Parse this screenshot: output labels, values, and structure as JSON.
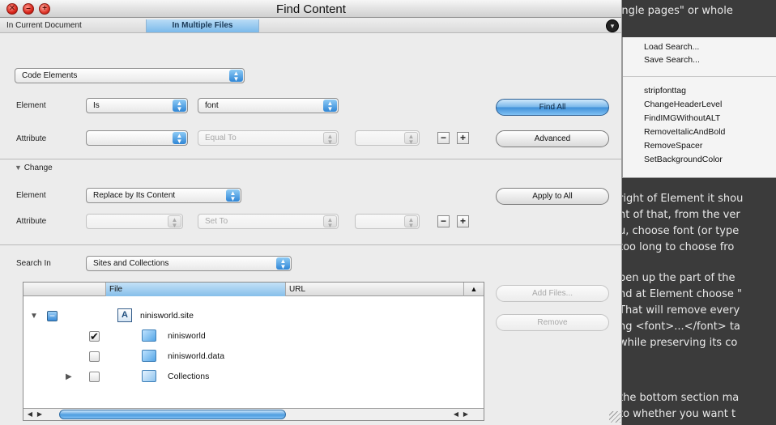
{
  "window": {
    "title": "Find Content"
  },
  "tabs": {
    "current_document": "In Current Document",
    "multiple_files": "In Multiple Files"
  },
  "find": {
    "type_select": "Code Elements",
    "element_label": "Element",
    "element_op": "Is",
    "element_value": "font",
    "attribute_label": "Attribute",
    "attribute_name": "",
    "attribute_op": "Equal To",
    "attribute_value": "",
    "find_all": "Find All",
    "advanced": "Advanced"
  },
  "change": {
    "section_label": "Change",
    "element_label": "Element",
    "element_action": "Replace by Its Content",
    "attribute_label": "Attribute",
    "attribute_name": "",
    "attribute_op": "Set To",
    "attribute_value": "",
    "apply_to_all": "Apply to All"
  },
  "search_in": {
    "label": "Search In",
    "value": "Sites and Collections",
    "add_files": "Add Files...",
    "remove": "Remove"
  },
  "table": {
    "columns": [
      "File",
      "URL"
    ],
    "rows": [
      {
        "name": "ninisworld.site",
        "checked": "mixed"
      },
      {
        "name": "ninisworld",
        "checked": true
      },
      {
        "name": "ninisworld.data",
        "checked": false
      },
      {
        "name": "Collections",
        "checked": false
      }
    ]
  },
  "menu": {
    "items_top": [
      "Load Search...",
      "Save Search..."
    ],
    "items_saved": [
      "stripfonttag",
      "ChangeHeaderLevel",
      "FindIMGWithoutALT",
      "RemoveItalicAndBold",
      "RemoveSpacer",
      "SetBackgroundColor"
    ]
  },
  "background_text": {
    "top": "single pages\" or whole",
    "lines": [
      "right of Element it shou",
      "ht of that, from the ver",
      "u, choose font (or type",
      "too long to choose fro",
      "",
      "pen up the part of the",
      "nd at Element choose \"",
      "That will remove every",
      "ng <font>...</font> ta",
      "while preserving its co",
      "",
      "the bottom section ma",
      "to whether you want t"
    ]
  },
  "icons": {
    "close": "close-icon",
    "minimize": "minimize-icon",
    "zoom": "zoom-icon",
    "action_menu": "action-menu-icon",
    "disclosure_open": "triangle-down-icon",
    "disclosure_closed": "triangle-right-icon",
    "folder": "folder-icon",
    "site": "site-file-icon"
  }
}
